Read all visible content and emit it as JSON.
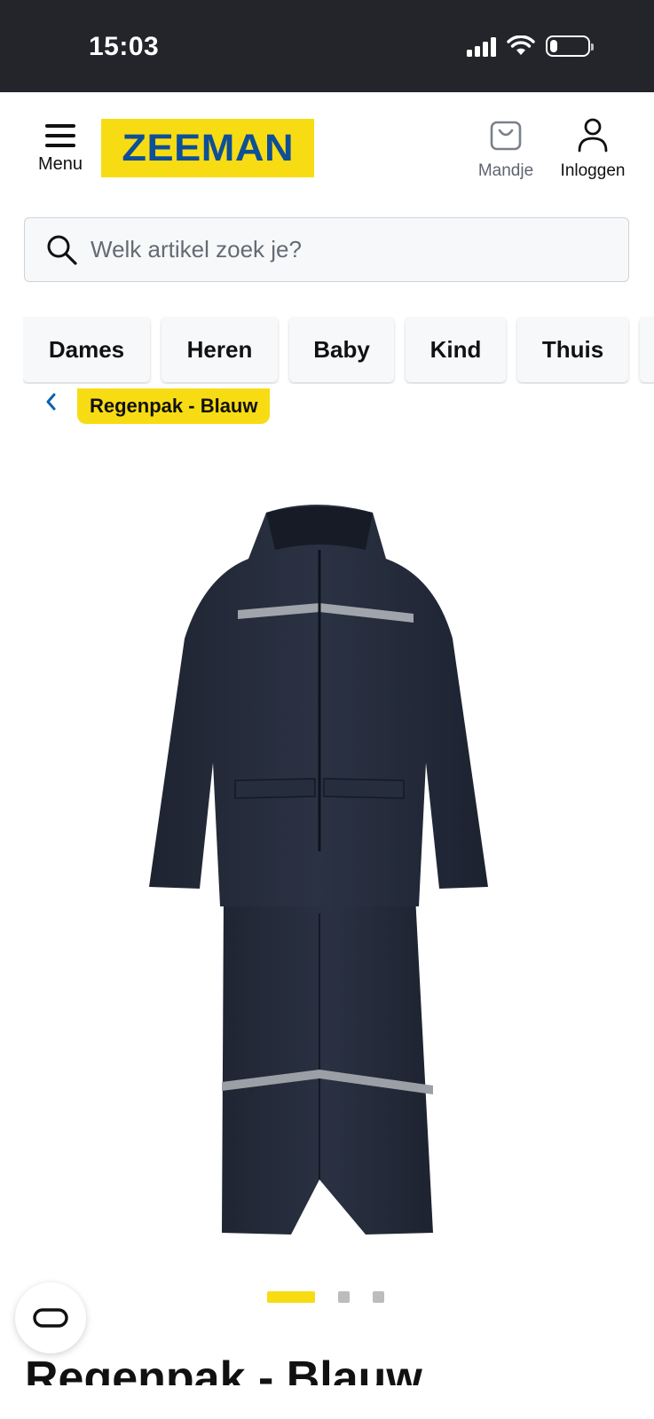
{
  "status_bar": {
    "time": "15:03",
    "icons": [
      "signal-icon",
      "wifi-icon",
      "battery-icon"
    ],
    "battery_level": 0.2
  },
  "header": {
    "menu_label": "Menu",
    "logo_text": "ZEEMAN",
    "cart_label": "Mandje",
    "login_label": "Inloggen"
  },
  "search": {
    "placeholder": "Welk artikel zoek je?"
  },
  "categories": [
    "Dames",
    "Heren",
    "Baby",
    "Kind",
    "Thuis"
  ],
  "breadcrumb": {
    "current": "Regenpak - Blauw"
  },
  "carousel": {
    "total": 3,
    "active": 1
  },
  "product": {
    "title": "Regenpak - Blauw"
  },
  "colors": {
    "brand_yellow": "#f8dc13",
    "brand_blue": "#0e4f96",
    "status_bar": "#24252a"
  }
}
